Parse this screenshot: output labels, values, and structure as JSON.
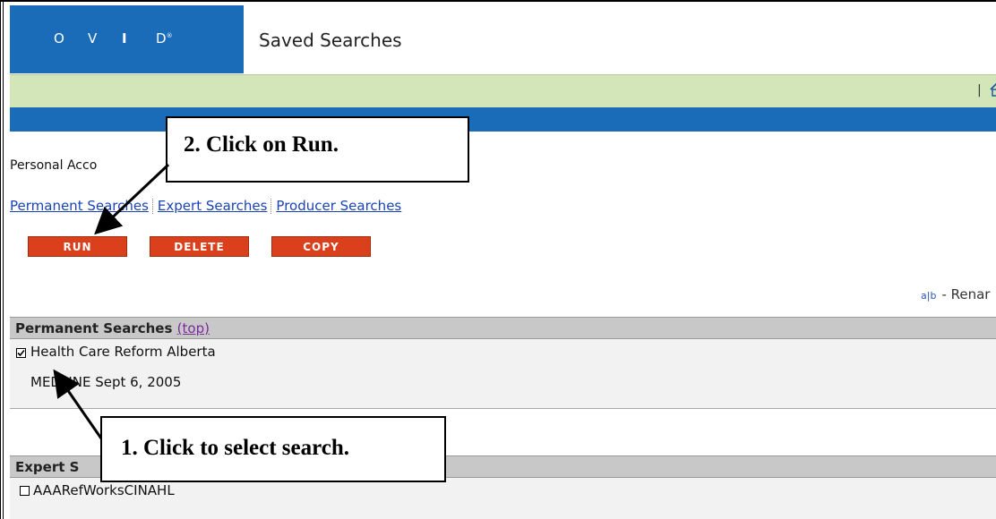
{
  "header": {
    "logo_letters": [
      "O",
      "V",
      "I",
      "D"
    ],
    "logo_reg": "®",
    "title": "Saved Searches"
  },
  "greenbar": {
    "separator": "|",
    "home_icon": "home-icon"
  },
  "personal_account_label": "Personal Acco",
  "nav_links": [
    "Permanent Searches",
    "Expert Searches",
    "Producer Searches"
  ],
  "buttons": {
    "run": "RUN",
    "delete": "DELETE",
    "copy": "COPY"
  },
  "rename": {
    "icon": "a|b",
    "label": "- Renar"
  },
  "sections": [
    {
      "title": "Permanent Searches",
      "top_link": "(top)",
      "items": [
        {
          "checked": true,
          "title": "Health Care Reform Alberta",
          "sub": "MEDLINE Sept 6, 2005"
        }
      ]
    },
    {
      "title": "Expert S",
      "items": [
        {
          "checked": false,
          "title": "AAARefWorksCINAHL"
        }
      ]
    }
  ],
  "callouts": {
    "step2": "2.  Click on Run.",
    "step1": "1.  Click to select search."
  },
  "colors": {
    "brand_blue": "#1a6cb8",
    "nav_green": "#d3e6b9",
    "button_red": "#d9401b",
    "section_gray": "#c8c8c8"
  }
}
